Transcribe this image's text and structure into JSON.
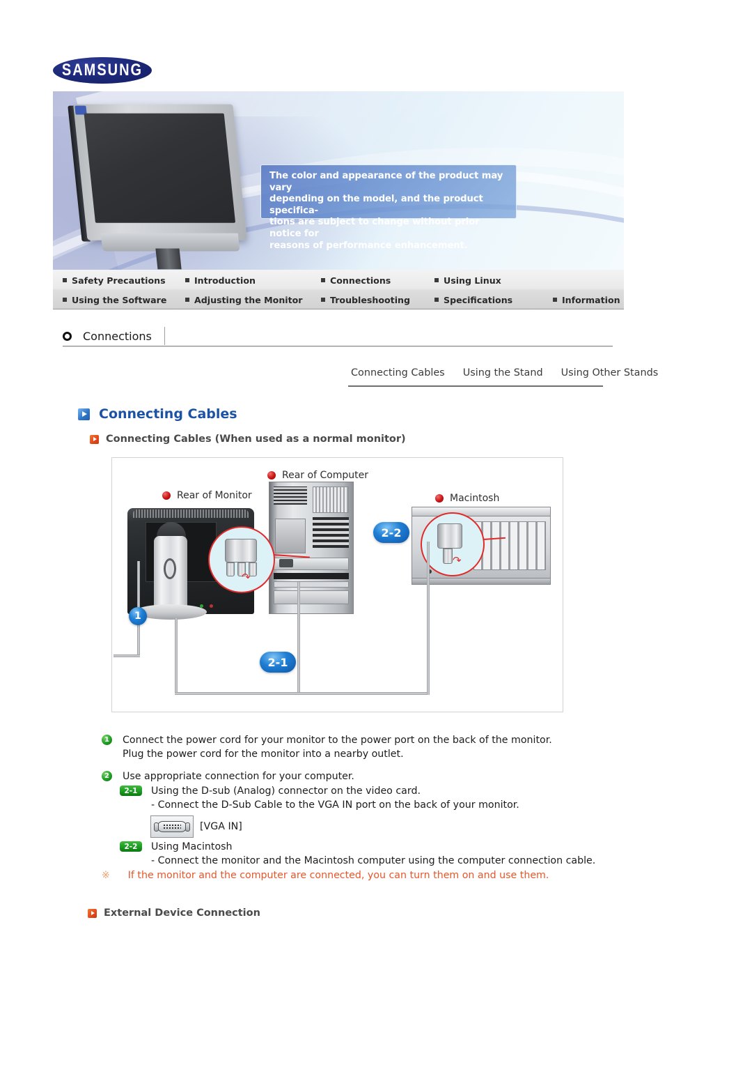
{
  "brand": {
    "logo_text": "SAMSUNG"
  },
  "banner": {
    "note_lines": [
      "The color and appearance of the product may vary",
      "depending on the model, and the product specifica-",
      "tions are subject to change without prior notice for",
      "reasons of performance enhancement."
    ]
  },
  "nav": {
    "row1": [
      {
        "label": "Safety Precautions"
      },
      {
        "label": "Introduction"
      },
      {
        "label": "Connections"
      },
      {
        "label": "Using Linux"
      }
    ],
    "row2": [
      {
        "label": "Using the Software"
      },
      {
        "label": "Adjusting the Monitor"
      },
      {
        "label": "Troubleshooting"
      },
      {
        "label": "Specifications"
      },
      {
        "label": "Information"
      }
    ]
  },
  "breadcrumb": {
    "label": "Connections"
  },
  "subtabs": [
    {
      "label": "Connecting Cables"
    },
    {
      "label": "Using the Stand"
    },
    {
      "label": "Using Other Stands"
    }
  ],
  "section": {
    "title": "Connecting Cables",
    "sub_heading": "Connecting Cables (When used as a normal monitor)",
    "bottom_heading": "External Device Connection"
  },
  "diagram": {
    "labels": {
      "monitor": "Rear of Monitor",
      "computer": "Rear of Computer",
      "macintosh": "Macintosh"
    },
    "callouts": {
      "one": "1",
      "two_one": "2-1",
      "two_two": "2-2"
    }
  },
  "instructions": {
    "steps": [
      {
        "num": "1",
        "line1": "Connect the power cord for your monitor to the power port on the back of the monitor.",
        "line2": "Plug the power cord for the monitor into a nearby outlet."
      },
      {
        "num": "2",
        "line1": "Use appropriate connection for your computer.",
        "line2": ""
      }
    ],
    "substeps": [
      {
        "tag": "2-1",
        "line1": "Using the D-sub (Analog) connector on the video card.",
        "line2": "- Connect the D-Sub Cable to the VGA IN port on the back of your monitor."
      },
      {
        "tag": "2-2",
        "line1": "Using Macintosh",
        "line2": "- Connect the monitor and the Macintosh computer using the computer connection cable."
      }
    ],
    "vga_label": "[VGA IN]",
    "note_symbol": "※",
    "note_text": "If the monitor and the computer are connected, you can turn them on and use them."
  },
  "colors": {
    "samsung_blue": "#1d2a7a",
    "section_title_blue": "#1c52a6",
    "accent_orange": "#e8562a",
    "callout_blue": "#1f7fd4",
    "step_green": "#1f9e24"
  }
}
